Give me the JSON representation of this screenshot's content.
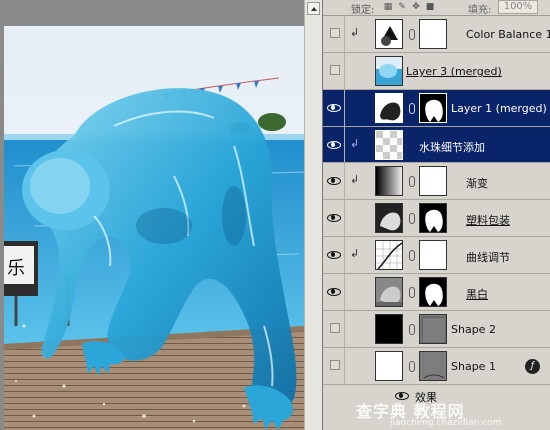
{
  "panel_top": {
    "lock_label": "锁定:",
    "fill_label": "填充:",
    "fill_value": "100%"
  },
  "layers": [
    {
      "name": "Color Balance 1",
      "visible": false,
      "selected": false,
      "clipped": true,
      "underline": false
    },
    {
      "name": "Layer 3 (merged)",
      "visible": false,
      "selected": false,
      "clipped": false,
      "underline": true
    },
    {
      "name": "Layer 1 (merged) ...",
      "visible": true,
      "selected": true,
      "clipped": false,
      "underline": false
    },
    {
      "name": "水珠细节添加",
      "visible": true,
      "selected": true,
      "clipped": true,
      "underline": false
    },
    {
      "name": "渐变",
      "visible": true,
      "selected": false,
      "clipped": true,
      "underline": false
    },
    {
      "name": "塑料包装",
      "visible": true,
      "selected": false,
      "clipped": false,
      "underline": true
    },
    {
      "name": "曲线调节",
      "visible": true,
      "selected": false,
      "clipped": true,
      "underline": false
    },
    {
      "name": "黑白",
      "visible": true,
      "selected": false,
      "clipped": false,
      "underline": true
    },
    {
      "name": "Shape 2",
      "visible": false,
      "selected": false,
      "clipped": false,
      "underline": false
    },
    {
      "name": "Shape 1",
      "visible": false,
      "selected": false,
      "clipped": false,
      "underline": false
    }
  ],
  "effects_label": "效果",
  "watermark": {
    "main": "查字典 教程网",
    "sub": "jiaocheng.chazidian.com"
  },
  "colors": {
    "selected_bg": "#0a246a",
    "panel_bg": "#d6d4cd",
    "water_blue": "#2aa6d8"
  },
  "icons": {
    "visibility": "eye-icon",
    "link": "chain-link-icon",
    "effects": "fx-icon",
    "clip": "clipping-arrow-icon"
  }
}
